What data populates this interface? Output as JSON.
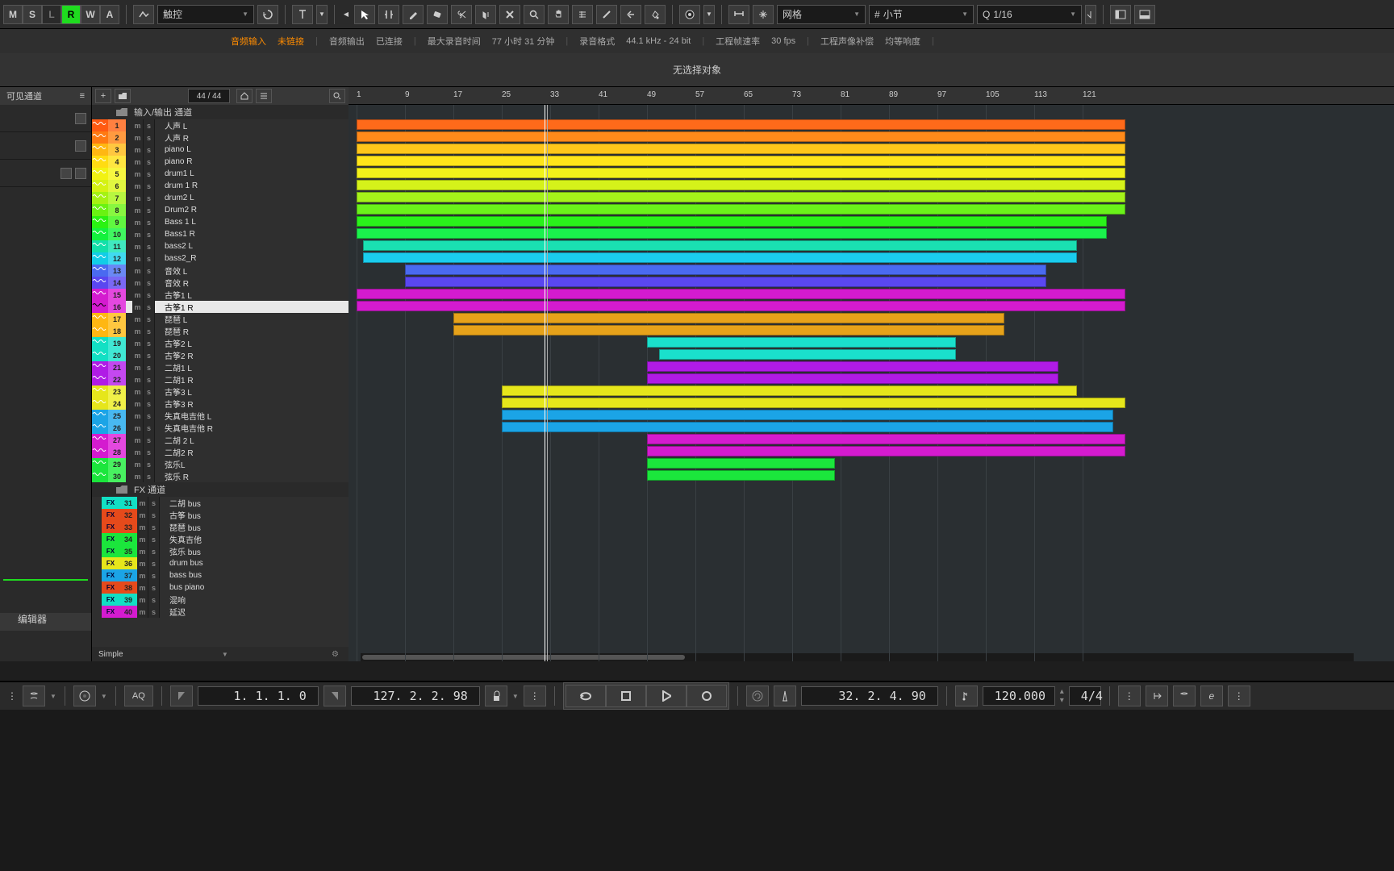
{
  "toolbar": {
    "auto_buttons": [
      "M",
      "S",
      "L",
      "R",
      "W",
      "A"
    ],
    "auto_active_index": 3,
    "touch_label": "触控",
    "grid_label": "网格",
    "bar_label": "小节",
    "frac_label": "1/16",
    "right_icons": {
      "zone_a": "open",
      "zone_b": "open"
    }
  },
  "status": {
    "audio_in_label": "音频输入",
    "audio_in_state": "未链接",
    "audio_out_label": "音频输出",
    "audio_out_state": "已连接",
    "max_rec_label": "最大录音时间",
    "max_rec_value": "77 小时 31 分钟",
    "format_label": "录音格式",
    "format_value": "44.1 kHz - 24 bit",
    "framerate_label": "工程帧速率",
    "framerate_value": "30 fps",
    "pan_label": "工程声像补偿",
    "pan_value": "均等响度"
  },
  "info_bar": {
    "text": "无选择对象"
  },
  "left_panel": {
    "visible_label": "可见通道",
    "editor_label": "编辑器"
  },
  "track_toolbar": {
    "count": "44 / 44"
  },
  "folders": {
    "io": "输入/输出 通道",
    "fx": "FX 通道"
  },
  "ruler_bars": [
    1,
    9,
    17,
    25,
    33,
    41,
    49,
    57,
    65,
    73,
    81,
    89,
    97,
    105,
    113,
    121
  ],
  "tracks": [
    {
      "n": 1,
      "name": "人声 L",
      "color": "#ff5a12",
      "num_bg": "#ff8040",
      "wave": "#ff7733",
      "clip": {
        "s": 1,
        "e": 128,
        "c": "#ff6a1a"
      }
    },
    {
      "n": 2,
      "name": "人声 R",
      "color": "#ff7a12",
      "num_bg": "#ff9a40",
      "wave": "#ff9733",
      "clip": {
        "s": 1,
        "e": 128,
        "c": "#ff8a1a"
      }
    },
    {
      "n": 3,
      "name": "piano L",
      "color": "#ffb712",
      "num_bg": "#ffc740",
      "wave": "#ffc733",
      "clip": {
        "s": 1,
        "e": 128,
        "c": "#ffc71a"
      }
    },
    {
      "n": 4,
      "name": "piano R",
      "color": "#ffdc12",
      "num_bg": "#ffe640",
      "wave": "#ffe633",
      "clip": {
        "s": 1,
        "e": 128,
        "c": "#ffe61a"
      }
    },
    {
      "n": 5,
      "name": "drum1 L",
      "color": "#f2f212",
      "num_bg": "#f7f740",
      "wave": "#f7f733",
      "clip": {
        "s": 1,
        "e": 128,
        "c": "#f2f21a"
      }
    },
    {
      "n": 6,
      "name": "drum 1 R",
      "color": "#d5f212",
      "num_bg": "#e0f740",
      "wave": "#e0f733",
      "clip": {
        "s": 1,
        "e": 128,
        "c": "#d5f21a"
      }
    },
    {
      "n": 7,
      "name": "drum2 L",
      "color": "#a5f212",
      "num_bg": "#b8f740",
      "wave": "#b8f733",
      "clip": {
        "s": 1,
        "e": 128,
        "c": "#a5f21a"
      }
    },
    {
      "n": 8,
      "name": "Drum2 R",
      "color": "#6af212",
      "num_bg": "#88f740",
      "wave": "#88f733",
      "clip": {
        "s": 1,
        "e": 128,
        "c": "#6af21a"
      }
    },
    {
      "n": 9,
      "name": "Bass 1 L",
      "color": "#2af212",
      "num_bg": "#60f740",
      "wave": "#60f733",
      "clip": {
        "s": 1,
        "e": 125,
        "c": "#2af21a"
      }
    },
    {
      "n": 10,
      "name": "Bass1  R",
      "color": "#12f23c",
      "num_bg": "#40f760",
      "wave": "#40f760",
      "clip": {
        "s": 1,
        "e": 125,
        "c": "#1af24c"
      }
    },
    {
      "n": 11,
      "name": "bass2  L",
      "color": "#12e0aa",
      "num_bg": "#40e8c0",
      "wave": "#40e8c0",
      "clip": {
        "s": 2,
        "e": 120,
        "c": "#1ae0b2"
      }
    },
    {
      "n": 12,
      "name": "bass2_R",
      "color": "#12cde6",
      "num_bg": "#40daf0",
      "wave": "#40daf0",
      "clip": {
        "s": 2,
        "e": 120,
        "c": "#1acdee"
      }
    },
    {
      "n": 13,
      "name": "音效 L",
      "color": "#4a6af0",
      "num_bg": "#6a88f5",
      "wave": "#6a88f5",
      "clip": {
        "s": 9,
        "e": 115,
        "c": "#4a6af0"
      }
    },
    {
      "n": 14,
      "name": "音效 R",
      "color": "#5a47f0",
      "num_bg": "#7a68f5",
      "wave": "#7a68f5",
      "clip": {
        "s": 9,
        "e": 115,
        "c": "#5a47f0"
      }
    },
    {
      "n": 15,
      "name": "古筝1 L",
      "color": "#d41bcf",
      "num_bg": "#e448df",
      "wave": "#e448df",
      "clip": {
        "s": 1,
        "e": 128,
        "c": "#d41bcf"
      }
    },
    {
      "n": 16,
      "name": "古筝1 R",
      "color": "#d41bcf",
      "num_bg": "#e448df",
      "wave": "#e448df",
      "clip": {
        "s": 1,
        "e": 128,
        "c": "#d41bcf"
      },
      "selected": true
    },
    {
      "n": 17,
      "name": "琵琶 L",
      "color": "#ffb712",
      "num_bg": "#ffc740",
      "wave": "#ffc733",
      "clip": {
        "s": 17,
        "e": 108,
        "c": "#e6a21a"
      }
    },
    {
      "n": 18,
      "name": "琵琶 R",
      "color": "#ffb712",
      "num_bg": "#ffc740",
      "wave": "#ffc733",
      "clip": {
        "s": 17,
        "e": 108,
        "c": "#e6a21a"
      }
    },
    {
      "n": 19,
      "name": "古筝2 L",
      "color": "#12e0c4",
      "num_bg": "#40e8d4",
      "wave": "#40e8d4",
      "clip": {
        "s": 49,
        "e": 100,
        "c": "#1ae0cc"
      }
    },
    {
      "n": 20,
      "name": "古筝2 R",
      "color": "#12e0c4",
      "num_bg": "#40e8d4",
      "wave": "#40e8d4",
      "clip": {
        "s": 51,
        "e": 100,
        "c": "#1ae0cc"
      }
    },
    {
      "n": 21,
      "name": "二胡1 L",
      "color": "#b01be6",
      "num_bg": "#c448f0",
      "wave": "#c448f0",
      "clip": {
        "s": 49,
        "e": 117,
        "c": "#b01be6"
      }
    },
    {
      "n": 22,
      "name": "二胡1 R",
      "color": "#b01be6",
      "num_bg": "#c448f0",
      "wave": "#c448f0",
      "clip": {
        "s": 49,
        "e": 117,
        "c": "#b01be6"
      }
    },
    {
      "n": 23,
      "name": "古筝3 L",
      "color": "#e6e61b",
      "num_bg": "#f0f048",
      "wave": "#f0f048",
      "clip": {
        "s": 25,
        "e": 120,
        "c": "#e6e61b"
      }
    },
    {
      "n": 24,
      "name": "古筝3 R",
      "color": "#e6e61b",
      "num_bg": "#f0f048",
      "wave": "#f0f048",
      "clip": {
        "s": 25,
        "e": 128,
        "c": "#e6e61b"
      }
    },
    {
      "n": 25,
      "name": "失真电吉他 L",
      "color": "#1ba4e6",
      "num_bg": "#48b8f0",
      "wave": "#48b8f0",
      "clip": {
        "s": 25,
        "e": 126,
        "c": "#1ba4e6"
      }
    },
    {
      "n": 26,
      "name": "失真电吉他 R",
      "color": "#1ba4e6",
      "num_bg": "#48b8f0",
      "wave": "#48b8f0",
      "clip": {
        "s": 25,
        "e": 126,
        "c": "#1ba4e6"
      }
    },
    {
      "n": 27,
      "name": "二胡 2 L",
      "color": "#d41bcf",
      "num_bg": "#e448df",
      "wave": "#e448df",
      "clip": {
        "s": 49,
        "e": 128,
        "c": "#d41bcf"
      }
    },
    {
      "n": 28,
      "name": "二胡2 R",
      "color": "#d41bcf",
      "num_bg": "#e448df",
      "wave": "#e448df",
      "clip": {
        "s": 49,
        "e": 128,
        "c": "#d41bcf"
      }
    },
    {
      "n": 29,
      "name": "弦乐L",
      "color": "#1be63c",
      "num_bg": "#48f060",
      "wave": "#48f060",
      "clip": {
        "s": 49,
        "e": 80,
        "c": "#1be63c"
      }
    },
    {
      "n": 30,
      "name": "弦乐 R",
      "color": "#1be63c",
      "num_bg": "#48f060",
      "wave": "#48f060",
      "clip": {
        "s": 49,
        "e": 80,
        "c": "#1be63c"
      }
    }
  ],
  "fx_tracks": [
    {
      "n": 31,
      "name": "二胡 bus",
      "c": "#12e0c4"
    },
    {
      "n": 32,
      "name": "古筝 bus",
      "c": "#e64a1b"
    },
    {
      "n": 33,
      "name": "琵琶 bus",
      "c": "#e64a1b"
    },
    {
      "n": 34,
      "name": "失真吉他",
      "c": "#1be63c"
    },
    {
      "n": 35,
      "name": "弦乐 bus",
      "c": "#1be63c"
    },
    {
      "n": 36,
      "name": "drum bus",
      "c": "#e6e61b"
    },
    {
      "n": 37,
      "name": "bass bus",
      "c": "#1ba4e6"
    },
    {
      "n": 38,
      "name": "bus piano",
      "c": "#e64a1b"
    },
    {
      "n": 39,
      "name": "混响",
      "c": "#12e0c4"
    },
    {
      "n": 40,
      "name": "延迟",
      "c": "#d41bcf"
    }
  ],
  "arrange_footer": {
    "simple": "Simple"
  },
  "transport": {
    "aq": "AQ",
    "left_pos": "1.  1.  1.    0",
    "right_pos": "127.  2.  2.  98",
    "primary_pos": "32.  2.  4.  90",
    "tempo": "120.000",
    "sig": "4/4"
  }
}
